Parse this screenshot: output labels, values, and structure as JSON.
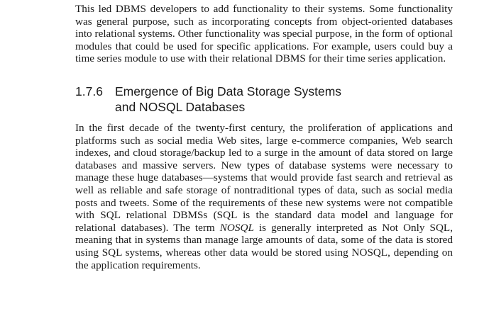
{
  "paragraph_1": "This led DBMS developers to add functionality to their systems. Some functionality was general purpose, such as incorporating concepts from object-oriented data­bases into relational systems. Other functionality was special purpose, in the form of optional modules that could be used for specific applications. For example, users could buy a time series module to use with their relational DBMS for their time series application.",
  "section": {
    "number": "1.7.6",
    "title_line_1": "Emergence of Big Data Storage Systems",
    "title_line_2": "and NOSQL Databases"
  },
  "paragraph_2": {
    "before_term": "In the first decade of the twenty-first century, the proliferation of applications and platforms such as social media Web sites, large e-commerce companies, Web search indexes, and cloud storage/backup led to a surge in the amount of data stored on large databases and massive servers. New types of database systems were necessary to manage these huge databases—systems that would provide fast search and retrieval as well as reliable and safe storage of nontraditional types of data, such as social media posts and tweets. Some of the requirements of these new systems were not compatible with SQL relational DBMSs (SQL is the standard data model and language for relational databases). The term ",
    "term": "NOSQL",
    "after_term": " is generally interpreted as Not Only SQL, meaning that in systems than manage large amounts of data, some of the data is stored using SQL systems, whereas other data would be stored using NOSQL, depending on the application requirements."
  }
}
